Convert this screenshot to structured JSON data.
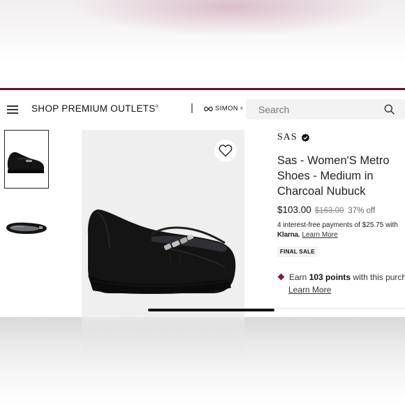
{
  "theme": {
    "accent": "#5c1438",
    "text": "#222222",
    "sale_diamond": "#7a1f4b"
  },
  "header": {
    "brand": "SHOP PREMIUM OUTLETS",
    "brand_mark": "®",
    "separator": "|",
    "partner": "SIMON",
    "partner_mark": "®",
    "search_placeholder": "Search"
  },
  "gallery": {
    "selected_index": 0,
    "thumbnails": [
      "shoe side view",
      "shoe top view"
    ]
  },
  "product": {
    "brand": "SAS",
    "title": "Sas - Women'S Metro Shoes - Medium in Charcoal Nubuck",
    "price": "$103.00",
    "original_price": "$163.00",
    "discount": "37% off",
    "klarna_text": "4 interest-free payments of $25.75 with",
    "klarna_brand": "Klarna.",
    "klarna_link": "Learn More",
    "badge": "FINAL SALE",
    "points_prefix": "Earn",
    "points_value": "103 points",
    "points_suffix": "with this purch",
    "points_link": "Learn More"
  }
}
